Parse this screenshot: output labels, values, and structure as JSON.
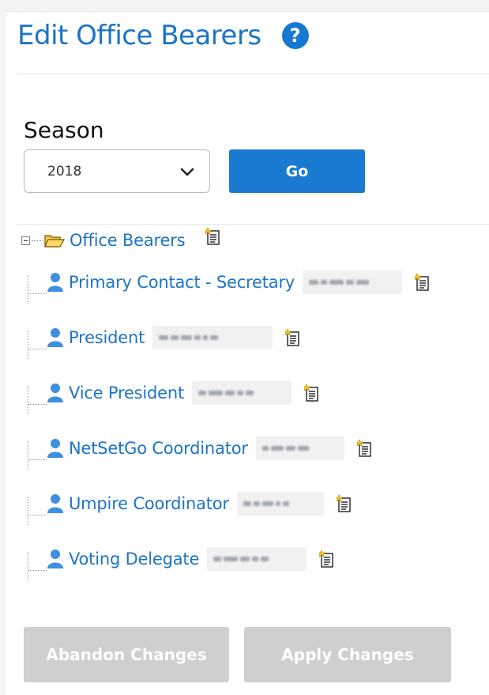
{
  "header": {
    "title": "Edit Office Bearers",
    "help_glyph": "?"
  },
  "season": {
    "label": "Season",
    "selected": "2018"
  },
  "actions": {
    "go_label": "Go",
    "abandon_label": "Abandon Changes",
    "apply_label": "Apply Changes"
  },
  "tree": {
    "root_label": "Office Bearers",
    "items": [
      {
        "label": "Primary Contact - Secretary"
      },
      {
        "label": "President"
      },
      {
        "label": "Vice President"
      },
      {
        "label": "NetSetGo Coordinator"
      },
      {
        "label": "Umpire Coordinator"
      },
      {
        "label": "Voting Delegate"
      }
    ]
  },
  "colors": {
    "accent": "#1a7ad2",
    "link": "#1c74c7",
    "disabled": "#cfcfcf"
  },
  "icons": {
    "help": "question-circle-icon",
    "dropdown": "chevron-down-icon",
    "folder": "folder-open-icon",
    "user": "user-icon",
    "note": "note-add-icon",
    "collapse": "minus-box-icon"
  }
}
